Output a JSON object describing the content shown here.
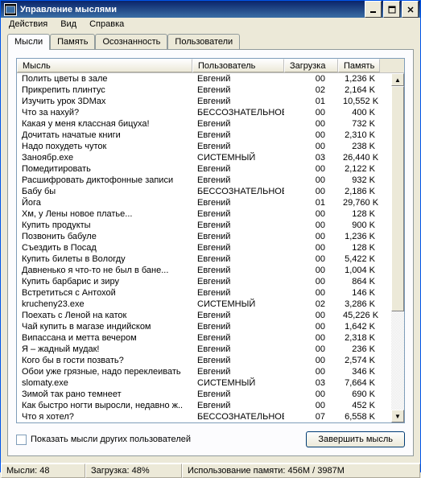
{
  "window": {
    "title": "Управление мыслями"
  },
  "menu": {
    "items": [
      "Действия",
      "Вид",
      "Справка"
    ]
  },
  "tabs": {
    "items": [
      "Мысли",
      "Память",
      "Осознанность",
      "Пользователи"
    ],
    "active": 0
  },
  "list": {
    "columns": {
      "thought": "Мысль",
      "user": "Пользователь",
      "load": "Загрузка",
      "memory": "Память"
    },
    "rows": [
      {
        "t": "Полить цветы в зале",
        "u": "Евгений",
        "l": "00",
        "m": "1,236 K"
      },
      {
        "t": "Прикрепить плинтус",
        "u": "Евгений",
        "l": "02",
        "m": "2,164 K"
      },
      {
        "t": "Изучить урок 3DMax",
        "u": "Евгений",
        "l": "01",
        "m": "10,552 K"
      },
      {
        "t": "Что за нахуй?",
        "u": "БЕССОЗНАТЕЛЬНОЕ",
        "l": "00",
        "m": "400 K"
      },
      {
        "t": "Какая у меня классная бицуха!",
        "u": "Евгений",
        "l": "00",
        "m": "732 K"
      },
      {
        "t": "Дочитать начатые книги",
        "u": "Евгений",
        "l": "00",
        "m": "2,310 K"
      },
      {
        "t": "Надо похудеть чуток",
        "u": "Евгений",
        "l": "00",
        "m": "238 K"
      },
      {
        "t": "Заноябр.exe",
        "u": "СИСТЕМНЫЙ",
        "l": "03",
        "m": "26,440 K"
      },
      {
        "t": "Помедитировать",
        "u": "Евгений",
        "l": "00",
        "m": "2,122 K"
      },
      {
        "t": "Расшифровать диктофонные записи",
        "u": "Евгений",
        "l": "00",
        "m": "932 K"
      },
      {
        "t": "Бабу бы",
        "u": "БЕССОЗНАТЕЛЬНОЕ",
        "l": "00",
        "m": "2,186 K"
      },
      {
        "t": "Йога",
        "u": "Евгений",
        "l": "01",
        "m": "29,760 K"
      },
      {
        "t": "Хм, у Лены новое платье...",
        "u": "Евгений",
        "l": "00",
        "m": "128 K"
      },
      {
        "t": "Купить продукты",
        "u": "Евгений",
        "l": "00",
        "m": "900 K"
      },
      {
        "t": "Позвонить бабуле",
        "u": "Евгений",
        "l": "00",
        "m": "1,236 K"
      },
      {
        "t": "Съездить в Посад",
        "u": "Евгений",
        "l": "00",
        "m": "128 K"
      },
      {
        "t": "Купить билеты в Вологду",
        "u": "Евгений",
        "l": "00",
        "m": "5,422 K"
      },
      {
        "t": "Давненько я что-то не был в бане...",
        "u": "Евгений",
        "l": "00",
        "m": "1,004 K"
      },
      {
        "t": "Купить барбарис и зиру",
        "u": "Евгений",
        "l": "00",
        "m": "864 K"
      },
      {
        "t": "Встретиться с Антохой",
        "u": "Евгений",
        "l": "00",
        "m": "146 K"
      },
      {
        "t": "krucheny23.exe",
        "u": "СИСТЕМНЫЙ",
        "l": "02",
        "m": "3,286 K"
      },
      {
        "t": "Поехать с Леной на каток",
        "u": "Евгений",
        "l": "00",
        "m": "45,226 K"
      },
      {
        "t": "Чай купить в магазе индийском",
        "u": "Евгений",
        "l": "00",
        "m": "1,642 K"
      },
      {
        "t": "Випассана и метта вечером",
        "u": "Евгений",
        "l": "00",
        "m": "2,318 K"
      },
      {
        "t": "Я – жадный мудак!",
        "u": "Евгений",
        "l": "00",
        "m": "236 K"
      },
      {
        "t": "Кого бы в гости позвать?",
        "u": "Евгений",
        "l": "00",
        "m": "2,574 K"
      },
      {
        "t": "Обои уже грязные, надо переклеивать",
        "u": "Евгений",
        "l": "00",
        "m": "346 K"
      },
      {
        "t": "slomaty.exe",
        "u": "СИСТЕМНЫЙ",
        "l": "03",
        "m": "7,664 K"
      },
      {
        "t": "Зимой так рано темнеет",
        "u": "Евгений",
        "l": "00",
        "m": "690 K"
      },
      {
        "t": "Как быстро ногти выросли, недавно ж..",
        "u": "Евгений",
        "l": "00",
        "m": "452 K"
      },
      {
        "t": "Что я хотел?",
        "u": "БЕССОЗНАТЕЛЬНОЕ",
        "l": "07",
        "m": "6,558 K"
      }
    ]
  },
  "bottom": {
    "checkbox_label": "Показать мысли других пользователей",
    "button_label": "Завершить мысль"
  },
  "status": {
    "thoughts": "Мысли: 48",
    "load": "Загрузка: 48%",
    "memory": "Использование памяти: 456M / 3987M"
  }
}
